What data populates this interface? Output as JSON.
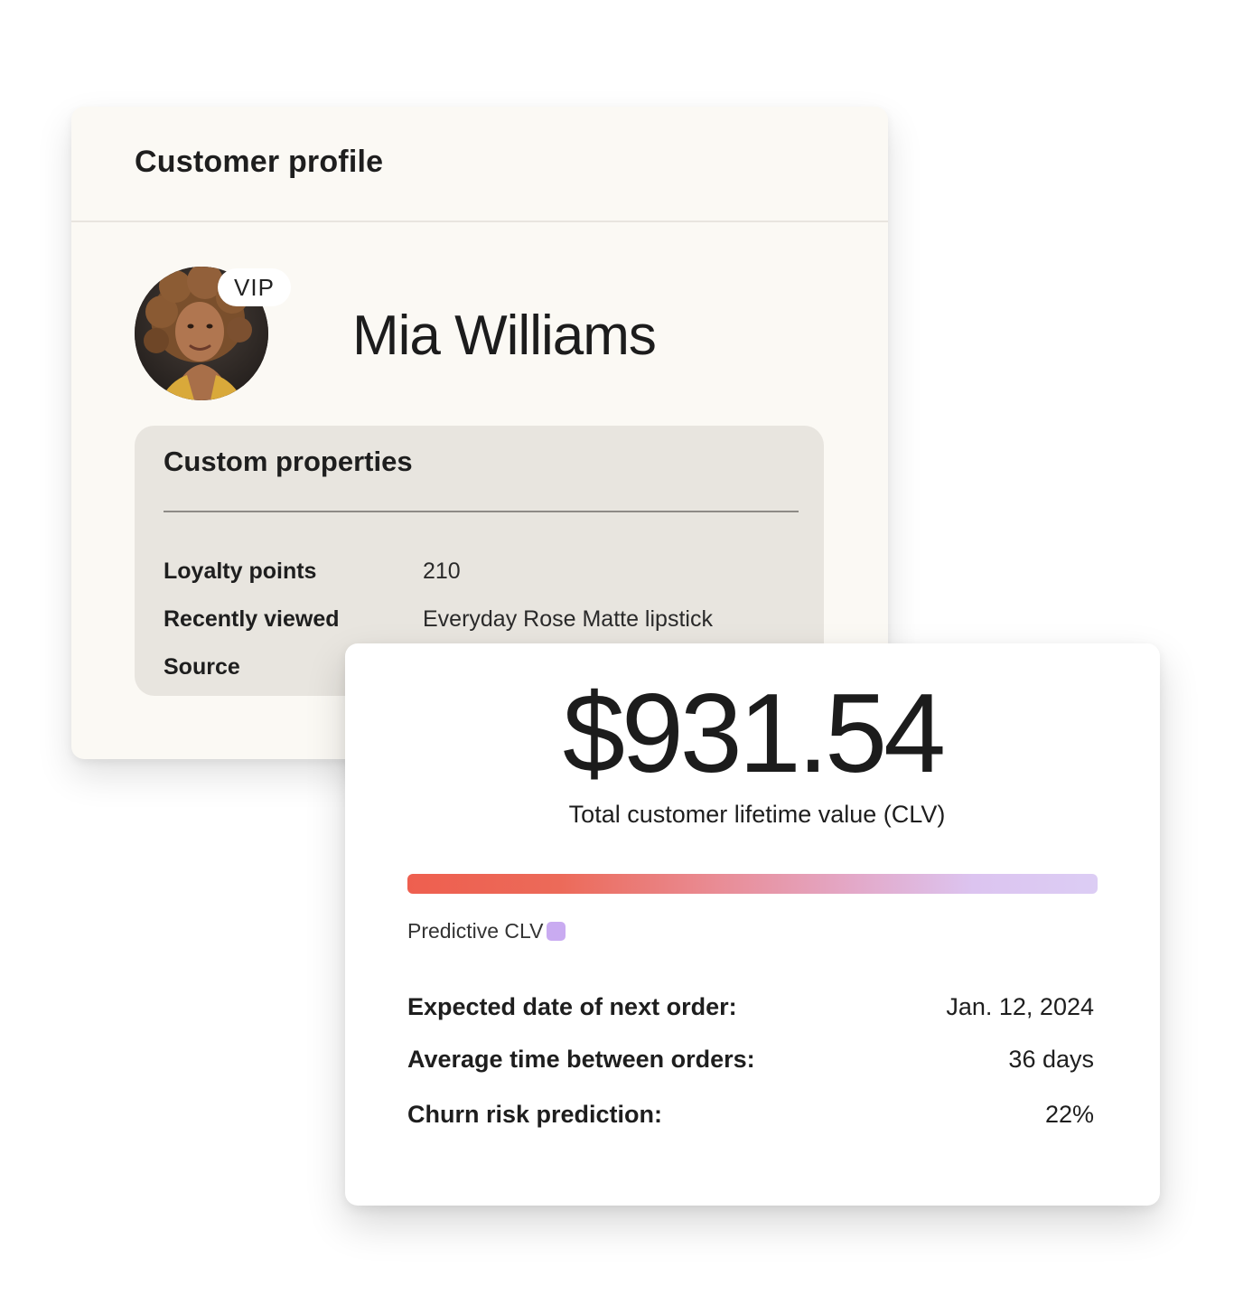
{
  "profile": {
    "title": "Customer profile",
    "badge": "VIP",
    "name": "Mia Williams",
    "avatar_icon": "customer-photo",
    "custom_properties": {
      "title": "Custom properties",
      "rows": [
        {
          "key": "Loyalty points",
          "value": "210"
        },
        {
          "key": "Recently viewed",
          "value": "Everyday Rose Matte lipstick"
        },
        {
          "key": "Source",
          "value": ""
        }
      ]
    }
  },
  "clv": {
    "amount": "$931.54",
    "caption": "Total customer lifetime value (CLV)",
    "legend_label": "Predictive CLV",
    "colors": {
      "bar_start": "#ee5f4f",
      "bar_end": "#dccdf4",
      "predictive_swatch": "#c9abf1"
    },
    "stats": [
      {
        "label": "Expected date of next order:",
        "value": "Jan. 12, 2024"
      },
      {
        "label": "Average time between orders:",
        "value": "36 days"
      },
      {
        "label": "Churn risk prediction:",
        "value": "22%"
      }
    ]
  }
}
